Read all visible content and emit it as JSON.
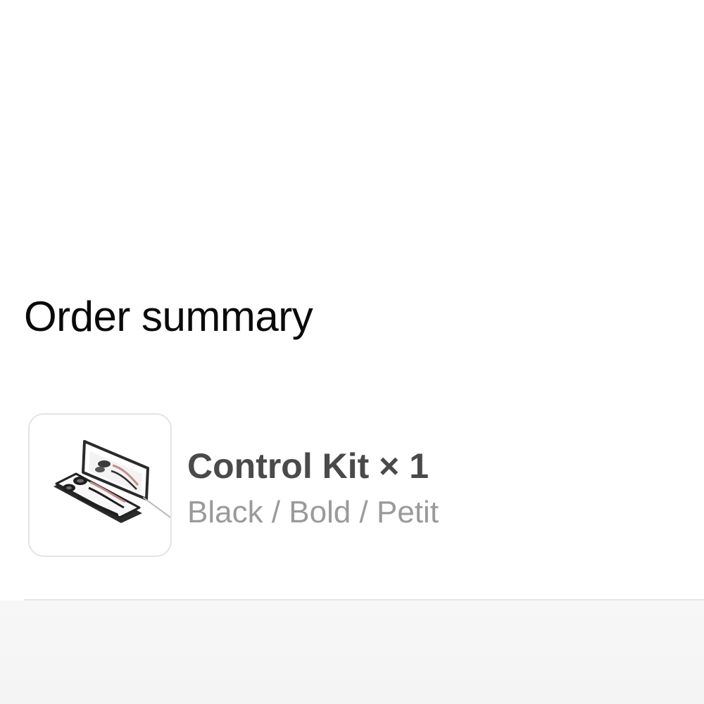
{
  "order_summary": {
    "title": "Order summary",
    "items": [
      {
        "name": "Control Kit × 1",
        "variant": "Black / Bold / Petit",
        "thumbnail_icon": "lash-kit-palette-icon"
      }
    ]
  },
  "colors": {
    "title_text": "#0a0a0a",
    "item_name_text": "#4a4a4a",
    "variant_text": "#9a9a9a",
    "divider": "#e6e6e6",
    "thumbnail_border": "#e4e4e4",
    "footer_background": "#f5f5f5"
  }
}
